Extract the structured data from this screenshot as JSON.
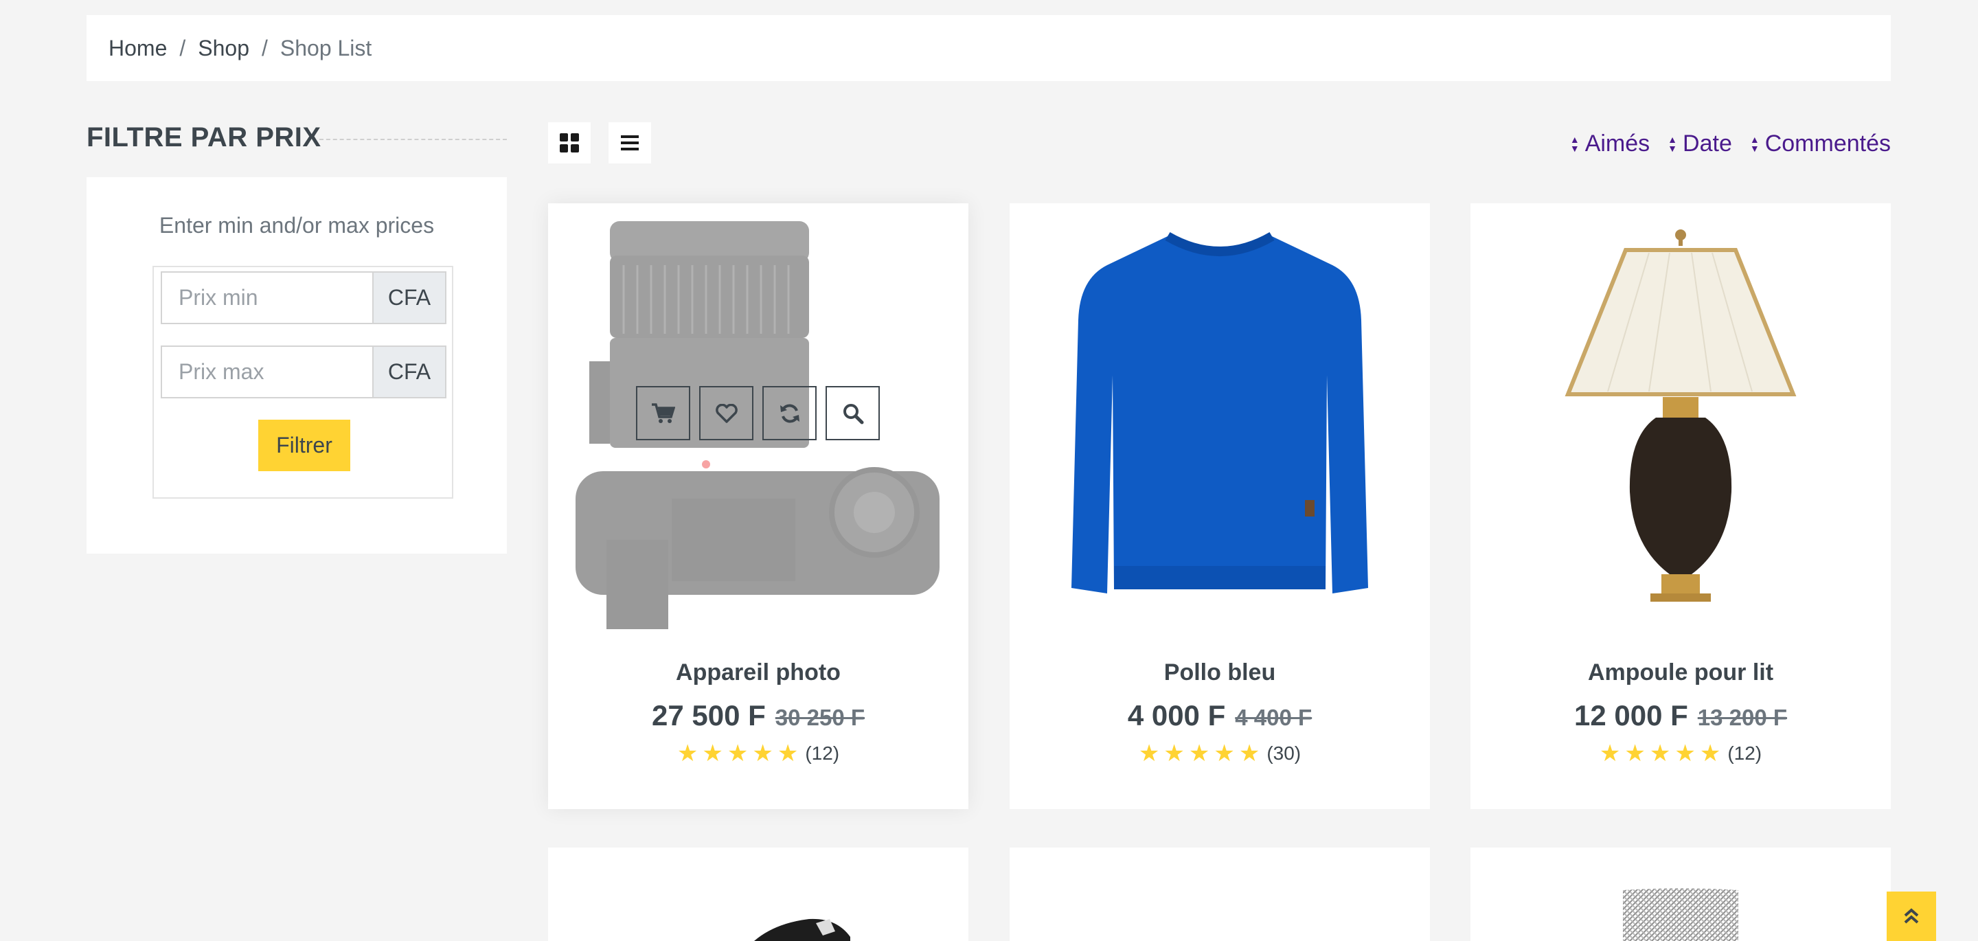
{
  "breadcrumb": {
    "home": "Home",
    "shop": "Shop",
    "current": "Shop List",
    "separator": "/"
  },
  "filter": {
    "title": "FILTRE PAR PRIX",
    "hint": "Enter min and/or max prices",
    "min_placeholder": "Prix min",
    "max_placeholder": "Prix max",
    "currency": "CFA",
    "button": "Filtrer"
  },
  "sort": {
    "likes": "Aimés",
    "date": "Date",
    "comments": "Commentés"
  },
  "products": [
    {
      "name": "Appareil photo",
      "price": "27 500 F",
      "old_price": "30 250 F",
      "rating": 5,
      "reviews": "(12)"
    },
    {
      "name": "Pollo bleu",
      "price": "4 000 F",
      "old_price": "4 400 F",
      "rating": 5,
      "reviews": "(30)"
    },
    {
      "name": "Ampoule pour lit",
      "price": "12 000 F",
      "old_price": "13 200 F",
      "rating": 5,
      "reviews": "(12)"
    }
  ],
  "colors": {
    "accent": "#ffd333",
    "sort_link": "#4a1a8c",
    "text": "#3d464d",
    "background": "#f4f4f4"
  },
  "icons": [
    "grid-view-icon",
    "list-view-icon",
    "sort-icon",
    "cart-icon",
    "heart-icon",
    "refresh-icon",
    "search-icon",
    "star-icon",
    "angle-double-up-icon"
  ]
}
